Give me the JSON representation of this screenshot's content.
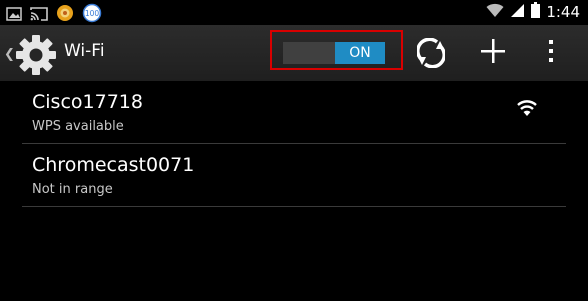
{
  "status_bar": {
    "time": "1:44",
    "left_icons": [
      "image-icon",
      "cast-icon",
      "app-notification-icon",
      "battery-percent-icon"
    ],
    "battery_badge": "100",
    "right_icons": [
      "wifi-signal-icon",
      "cell-signal-icon",
      "battery-icon"
    ]
  },
  "action_bar": {
    "title": "Wi-Fi",
    "toggle_label": "ON",
    "toggle_on": true,
    "actions": [
      "wps-icon",
      "add-network-icon",
      "overflow-menu-icon"
    ]
  },
  "networks": [
    {
      "ssid": "Cisco17718",
      "status": "WPS available",
      "has_signal": true
    },
    {
      "ssid": "Chromecast0071",
      "status": "Not in range",
      "has_signal": false
    }
  ],
  "colors": {
    "accent": "#1f8cc4",
    "highlight_frame": "#d90000",
    "background": "#000000"
  }
}
